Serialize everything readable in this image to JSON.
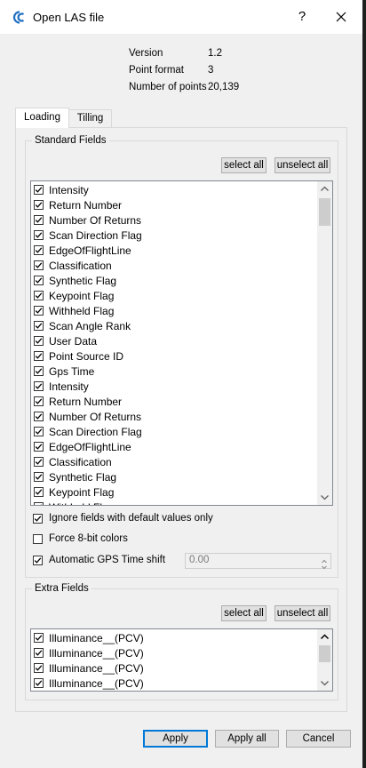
{
  "window": {
    "title": "Open LAS file",
    "help_symbol": "?"
  },
  "file_info": [
    {
      "label": "Version",
      "value": "1.2"
    },
    {
      "label": "Point format",
      "value": "3"
    },
    {
      "label": "Number of points",
      "value": "20,139"
    }
  ],
  "tabs": [
    {
      "label": "Loading",
      "active": true
    },
    {
      "label": "Tilling",
      "active": false
    }
  ],
  "standard_fields": {
    "group_title": "Standard Fields",
    "select_all_label": "select all",
    "unselect_all_label": "unselect all",
    "items": [
      {
        "label": "Intensity",
        "checked": true
      },
      {
        "label": "Return Number",
        "checked": true
      },
      {
        "label": "Number Of Returns",
        "checked": true
      },
      {
        "label": "Scan Direction Flag",
        "checked": true
      },
      {
        "label": "EdgeOfFlightLine",
        "checked": true
      },
      {
        "label": "Classification",
        "checked": true
      },
      {
        "label": "Synthetic Flag",
        "checked": true
      },
      {
        "label": "Keypoint Flag",
        "checked": true
      },
      {
        "label": "Withheld Flag",
        "checked": true
      },
      {
        "label": "Scan Angle Rank",
        "checked": true
      },
      {
        "label": "User Data",
        "checked": true
      },
      {
        "label": "Point Source ID",
        "checked": true
      },
      {
        "label": "Gps Time",
        "checked": true
      },
      {
        "label": "Intensity",
        "checked": true
      },
      {
        "label": "Return Number",
        "checked": true
      },
      {
        "label": "Number Of Returns",
        "checked": true
      },
      {
        "label": "Scan Direction Flag",
        "checked": true
      },
      {
        "label": "EdgeOfFlightLine",
        "checked": true
      },
      {
        "label": "Classification",
        "checked": true
      },
      {
        "label": "Synthetic Flag",
        "checked": true
      },
      {
        "label": "Keypoint Flag",
        "checked": true
      },
      {
        "label": "Withheld Flag",
        "checked": true
      }
    ]
  },
  "options": {
    "ignore_default": {
      "label": "Ignore fields with default values only",
      "checked": true
    },
    "force_8bit": {
      "label": "Force 8-bit colors",
      "checked": false
    },
    "gps_shift": {
      "label": "Automatic GPS Time shift",
      "checked": true,
      "value": "0.00"
    }
  },
  "extra_fields": {
    "group_title": "Extra Fields",
    "select_all_label": "select all",
    "unselect_all_label": "unselect all",
    "items": [
      {
        "label": "Illuminance__(PCV)",
        "checked": true
      },
      {
        "label": "Illuminance__(PCV)",
        "checked": true
      },
      {
        "label": "Illuminance__(PCV)",
        "checked": true
      },
      {
        "label": "Illuminance__(PCV)",
        "checked": true
      }
    ]
  },
  "footer": {
    "apply_label": "Apply",
    "apply_all_label": "Apply all",
    "cancel_label": "Cancel"
  },
  "colors": {
    "dialog_bg": "#f0f0f0",
    "accent": "#0078d7",
    "app_icon": "#1f6fc1"
  }
}
